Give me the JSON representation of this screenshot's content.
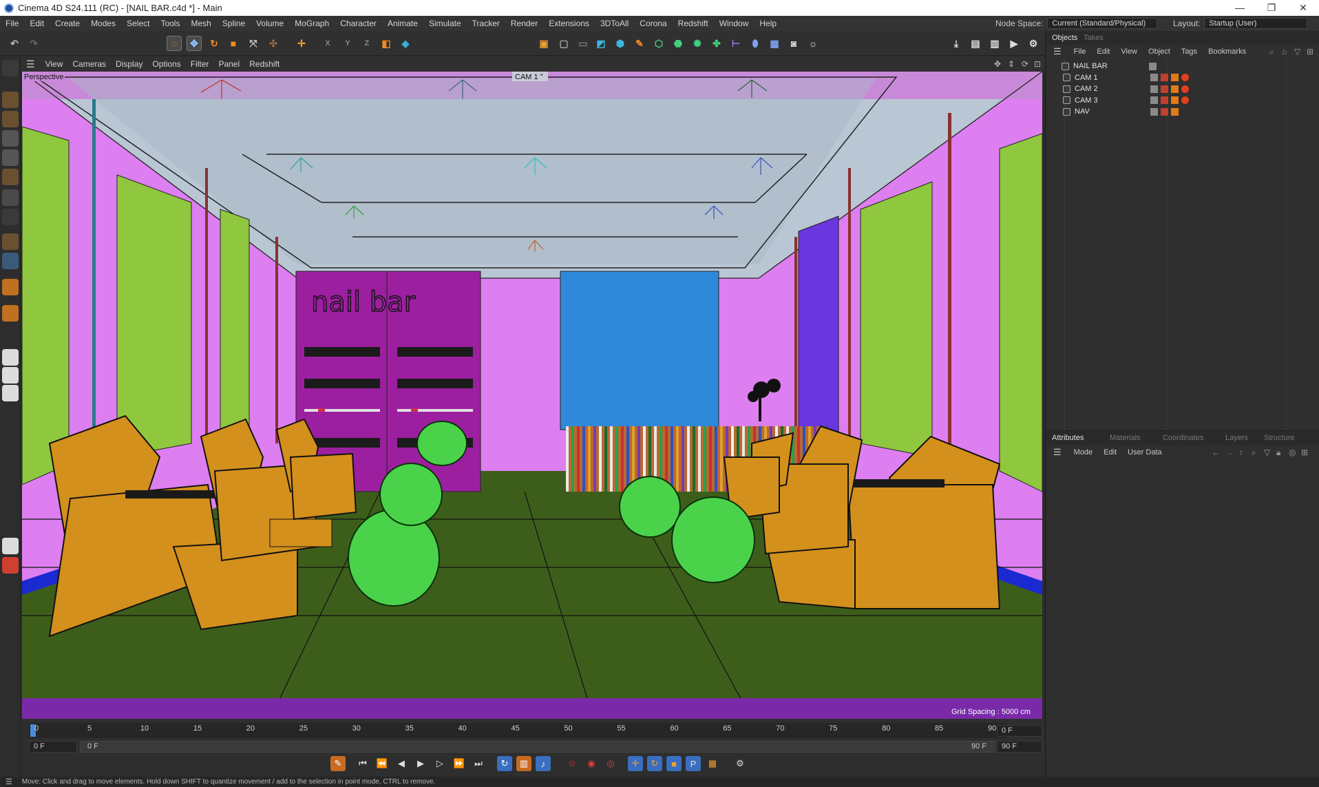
{
  "window": {
    "title": "Cinema 4D S24.111 (RC) - [NAIL BAR.c4d *] - Main",
    "minimize": "—",
    "restore": "❐",
    "close": "✕"
  },
  "menu": {
    "items": [
      "File",
      "Edit",
      "Create",
      "Modes",
      "Select",
      "Tools",
      "Mesh",
      "Spline",
      "Volume",
      "MoGraph",
      "Character",
      "Animate",
      "Simulate",
      "Tracker",
      "Render",
      "Extensions",
      "3DToAll",
      "Corona",
      "Redshift",
      "Window",
      "Help"
    ],
    "node_space_label": "Node Space:",
    "node_space_value": "Current (Standard/Physical)",
    "layout_label": "Layout:",
    "layout_value": "Startup (User)"
  },
  "viewport_menu": {
    "items": [
      "View",
      "Cameras",
      "Display",
      "Options",
      "Filter",
      "Panel",
      "Redshift"
    ]
  },
  "viewport": {
    "view_name": "Perspective",
    "camera_label": "CAM 1 °",
    "grid_spacing": "Grid Spacing : 5000 cm",
    "sign_text": "nail bar"
  },
  "timeline": {
    "ticks": [
      "0",
      "5",
      "10",
      "15",
      "20",
      "25",
      "30",
      "35",
      "40",
      "45",
      "50",
      "55",
      "60",
      "65",
      "70",
      "75",
      "80",
      "85",
      "90"
    ],
    "current_frame_right": "0 F",
    "start_field": "0 F",
    "range_start": "0 F",
    "range_end": "90 F",
    "end_field": "90 F"
  },
  "status": {
    "text": "Move: Click and drag to move elements. Hold down SHIFT to quantize movement / add to the selection in point mode, CTRL to remove."
  },
  "objects_panel": {
    "tabs": [
      "Objects",
      "Takes"
    ],
    "menu": [
      "File",
      "Edit",
      "View",
      "Object",
      "Tags",
      "Bookmarks"
    ],
    "items": [
      {
        "name": "NAIL BAR",
        "level": 0
      },
      {
        "name": "CAM 1",
        "level": 1
      },
      {
        "name": "CAM 2",
        "level": 1
      },
      {
        "name": "CAM 3",
        "level": 1
      },
      {
        "name": "NAV",
        "level": 1
      }
    ]
  },
  "attributes_panel": {
    "tabs": [
      "Attributes",
      "Materials",
      "Coordinates",
      "Layers",
      "Structure"
    ],
    "menu": [
      "Mode",
      "Edit",
      "User Data"
    ]
  },
  "colors": {
    "accent": "#e27a18",
    "wall": "#dd7ff0",
    "floor": "#3d5e1b",
    "ceiling": "#b9c6d4",
    "chair": "#d4901c",
    "pouf": "#4bd24b",
    "panel_green": "#8fc73e",
    "cabinet": "#9c1fa0",
    "reception_blue": "#2f89da"
  }
}
